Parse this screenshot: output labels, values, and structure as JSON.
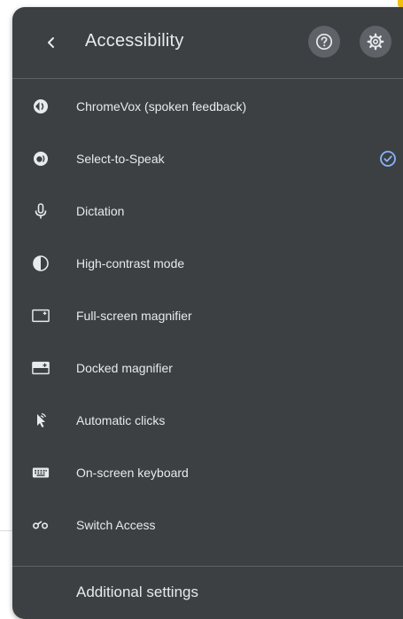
{
  "header": {
    "title": "Accessibility",
    "back_icon": "chevron-left-icon",
    "help_icon": "help-circle-icon",
    "settings_icon": "gear-icon"
  },
  "items": [
    {
      "label": "ChromeVox (spoken feedback)",
      "icon": "chromevox-icon",
      "checked": false
    },
    {
      "label": "Select-to-Speak",
      "icon": "select-to-speak-icon",
      "checked": true
    },
    {
      "label": "Dictation",
      "icon": "microphone-icon",
      "checked": false
    },
    {
      "label": "High-contrast mode",
      "icon": "contrast-icon",
      "checked": false
    },
    {
      "label": "Full-screen magnifier",
      "icon": "fullscreen-magnifier-icon",
      "checked": false
    },
    {
      "label": "Docked magnifier",
      "icon": "docked-magnifier-icon",
      "checked": false
    },
    {
      "label": "Automatic clicks",
      "icon": "automatic-clicks-icon",
      "checked": false
    },
    {
      "label": "On-screen keyboard",
      "icon": "keyboard-icon",
      "checked": false
    },
    {
      "label": "Switch Access",
      "icon": "switch-access-icon",
      "checked": false
    }
  ],
  "footer": {
    "label": "Additional settings"
  },
  "colors": {
    "panel_bg": "#3c4043",
    "text": "#e8eaed",
    "button_bg": "#5f6368",
    "check": "#8ab4f8"
  }
}
